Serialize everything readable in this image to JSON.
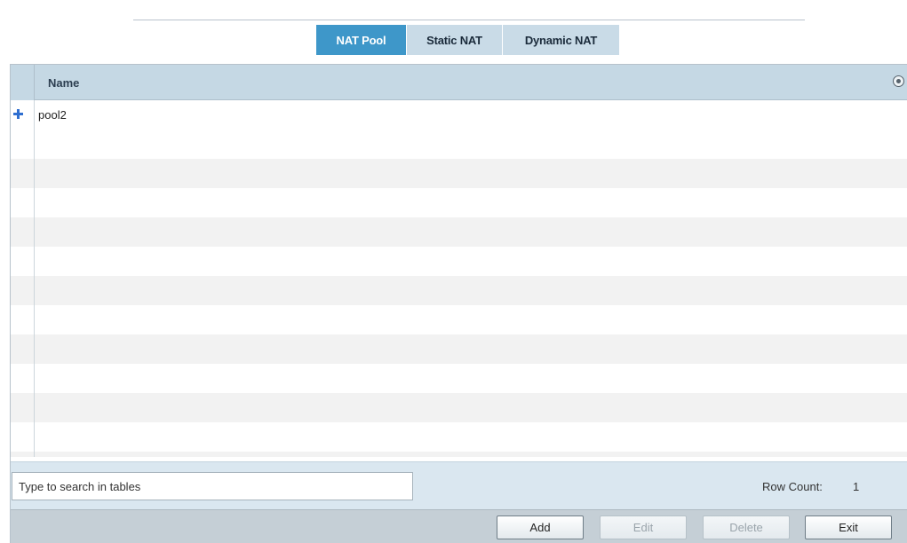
{
  "tabs": [
    {
      "label": "NAT Pool",
      "active": true
    },
    {
      "label": "Static NAT",
      "active": false
    },
    {
      "label": "Dynamic NAT",
      "active": false
    }
  ],
  "table": {
    "columns": [
      "Name"
    ],
    "rows": [
      {
        "name": "pool2"
      }
    ],
    "column_menu_icon": "circle-down-icon",
    "row_icon": "plus-icon"
  },
  "search": {
    "placeholder": "Type to search in tables",
    "value": ""
  },
  "row_count": {
    "label": "Row Count:",
    "value": "1"
  },
  "buttons": {
    "add": "Add",
    "edit": "Edit",
    "delete": "Delete",
    "exit": "Exit"
  },
  "colors": {
    "tab_active": "#3e97c9",
    "tab_inactive": "#c9dbe7",
    "header_bg": "#c5d8e4",
    "search_bar_bg": "#dae7f0",
    "button_bar_bg": "#c5cfd6"
  }
}
